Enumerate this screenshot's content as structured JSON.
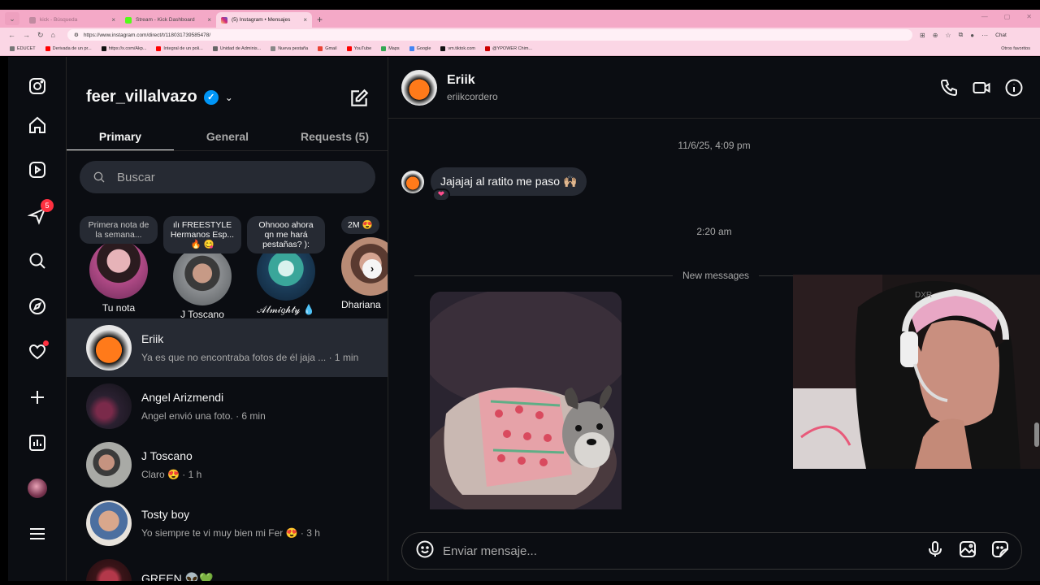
{
  "browser": {
    "tabs": [
      {
        "title": "kick - Búsqueda",
        "active": false,
        "color": "#c08aa0"
      },
      {
        "title": "Stream - Kick Dashboard",
        "active": false,
        "color": "#53fc18"
      },
      {
        "title": "(5) Instagram • Mensajes",
        "active": true,
        "color": "#d62976"
      }
    ],
    "url": "https://www.instagram.com/direct/t/118031739585478/",
    "chat_label": "Chat",
    "bookmarks": [
      {
        "label": "EDUCET",
        "color": "#777"
      },
      {
        "label": "Derivada de un pr...",
        "color": "#ff0000"
      },
      {
        "label": "https://x.com/Akp...",
        "color": "#111"
      },
      {
        "label": "Integral de un poli...",
        "color": "#ff0000"
      },
      {
        "label": "Unidad de Adminis...",
        "color": "#666"
      },
      {
        "label": "Nueva pestaña",
        "color": "#888"
      },
      {
        "label": "Gmail",
        "color": "#ea4335"
      },
      {
        "label": "YouTube",
        "color": "#ff0000"
      },
      {
        "label": "Maps",
        "color": "#34a853"
      },
      {
        "label": "Google",
        "color": "#4285f4"
      },
      {
        "label": "vm.tiktok.com",
        "color": "#111"
      },
      {
        "label": "@YPOWER Chim...",
        "color": "#cc0000"
      }
    ],
    "bookmarks_other": "Otros favoritos"
  },
  "sidebar": {
    "notifications_badge": "5"
  },
  "inbox": {
    "username": "feer_villalvazo",
    "verified_mark": "✓",
    "tabs": [
      "Primary",
      "General",
      "Requests (5)"
    ],
    "search_placeholder": "Buscar",
    "notes": [
      {
        "bubble": "Primera nota de la semana...",
        "name": "Tu nota"
      },
      {
        "bubble": "ılı FREESTYLE Hermanos Esp... 🔥 😋",
        "name": "J Toscano"
      },
      {
        "bubble": "Ohnooo ahora qn me hará pestañas? ):",
        "name": "𝒜𝓁𝓂𝒾𝑔𝒽𝓉𝓎 💧"
      },
      {
        "bubble": "2M 😍",
        "name": "Dhariana"
      }
    ],
    "conversations": [
      {
        "name": "Eriik",
        "preview": "Ya es que no encontraba fotos de él jaja ... · 1 min",
        "selected": true
      },
      {
        "name": "Angel Arizmendi",
        "preview": "Angel envió una foto. · 6 min",
        "selected": false
      },
      {
        "name": "J Toscano",
        "preview": "Claro 😍 · 1 h",
        "selected": false
      },
      {
        "name": "Tosty boy",
        "preview": "Yo siempre te vi muy bien mi Fer 😍 · 3 h",
        "selected": false
      },
      {
        "name": "GREEN 👽💚",
        "preview": "",
        "selected": false
      }
    ]
  },
  "chat": {
    "name": "Eriik",
    "handle": "eriikcordero",
    "timestamp1": "11/6/25, 4:09 pm",
    "message1": "Jajajaj al ratito me paso 🙌🏼",
    "reaction": "❤",
    "timestamp2": "2:20 am",
    "new_messages_label": "New messages",
    "composer_placeholder": "Enviar mensaje..."
  }
}
